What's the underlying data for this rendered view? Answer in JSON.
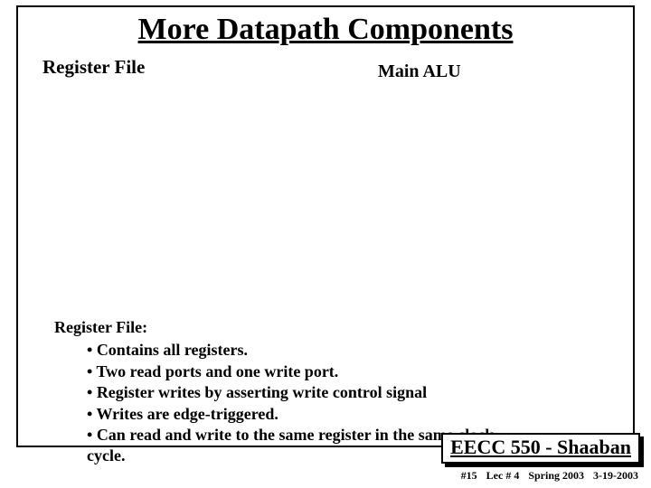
{
  "title": "More Datapath Components",
  "labels": {
    "left": "Register File",
    "right": "Main ALU"
  },
  "notes": {
    "header": "Register File:",
    "items": [
      "Contains all registers.",
      "Two read ports and one write port.",
      "Register writes by asserting write control signal",
      "Writes are edge-triggered.",
      "Can read and write to the same register in the same clock cycle."
    ]
  },
  "footer": {
    "course": "EECC 550 - Shaaban",
    "meta": {
      "slide": "#15",
      "lec": "Lec # 4",
      "term": "Spring 2003",
      "date": "3-19-2003"
    }
  }
}
